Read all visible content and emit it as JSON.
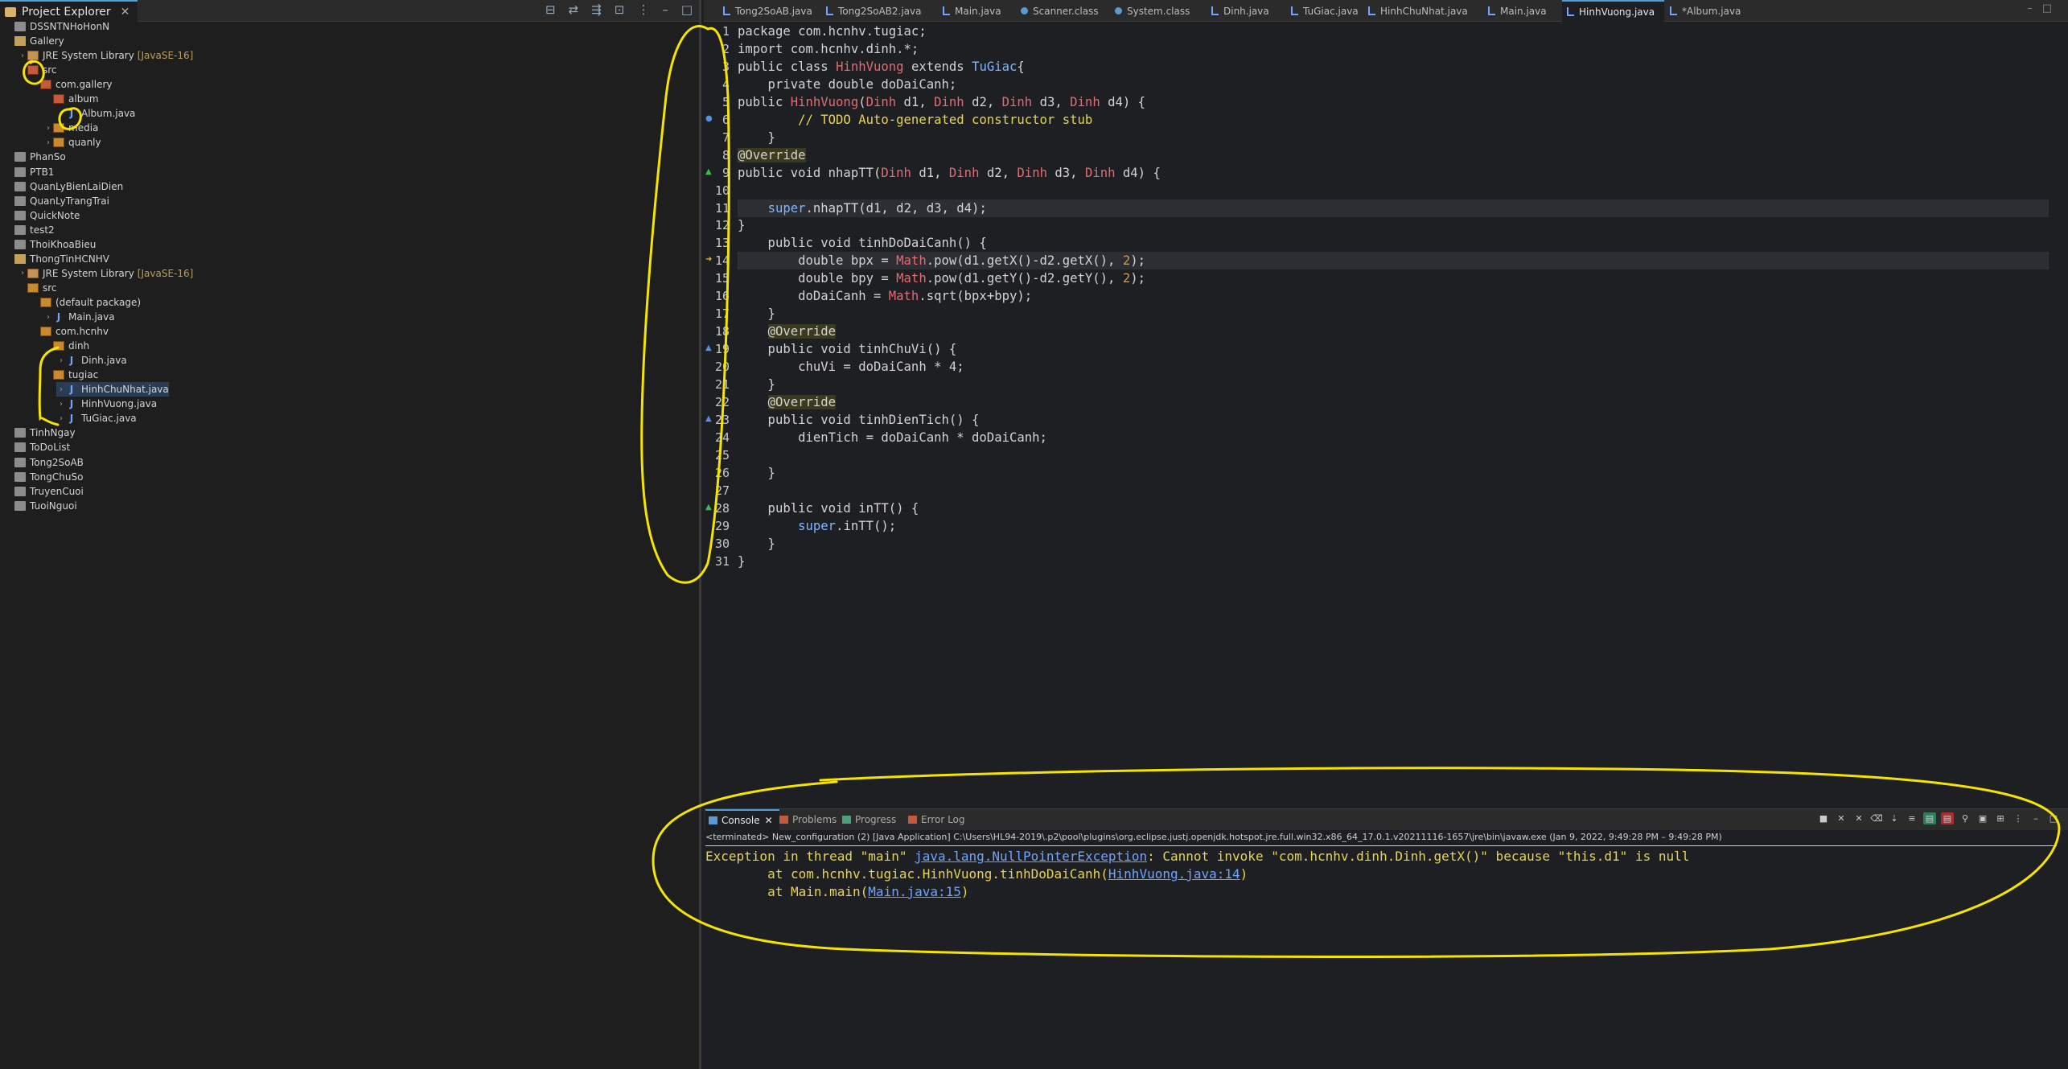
{
  "explorer": {
    "tab_label": "Project Explorer",
    "tree": [
      {
        "label": "DSSNTNHoHonN",
        "indent": 0,
        "kind": "folder"
      },
      {
        "label": "Gallery",
        "indent": 0,
        "kind": "folder-open"
      },
      {
        "label": "JRE System Library",
        "tag": "[JavaSE-16]",
        "indent": 1,
        "kind": "lib",
        "arrow": "›"
      },
      {
        "label": "src",
        "indent": 1,
        "kind": "pkg-err"
      },
      {
        "label": "com.gallery",
        "indent": 2,
        "kind": "pkg-err"
      },
      {
        "label": "album",
        "indent": 3,
        "kind": "pkg-err"
      },
      {
        "label": "Album.java",
        "indent": 4,
        "kind": "jfile"
      },
      {
        "label": "media",
        "indent": 3,
        "kind": "pkg",
        "arrow": "›"
      },
      {
        "label": "quanly",
        "indent": 3,
        "kind": "pkg",
        "arrow": "›"
      },
      {
        "label": "PhanSo",
        "indent": 0,
        "kind": "folder"
      },
      {
        "label": "PTB1",
        "indent": 0,
        "kind": "folder"
      },
      {
        "label": "QuanLyBienLaiDien",
        "indent": 0,
        "kind": "folder"
      },
      {
        "label": "QuanLyTrangTrai",
        "indent": 0,
        "kind": "folder"
      },
      {
        "label": "QuickNote",
        "indent": 0,
        "kind": "folder"
      },
      {
        "label": "test2",
        "indent": 0,
        "kind": "folder"
      },
      {
        "label": "ThoiKhoaBieu",
        "indent": 0,
        "kind": "folder"
      },
      {
        "label": "ThongTinHCNHV",
        "indent": 0,
        "kind": "folder-open"
      },
      {
        "label": "JRE System Library",
        "tag": "[JavaSE-16]",
        "indent": 1,
        "kind": "lib",
        "arrow": "›"
      },
      {
        "label": "src",
        "indent": 1,
        "kind": "pkg"
      },
      {
        "label": "(default package)",
        "indent": 2,
        "kind": "pkg"
      },
      {
        "label": "Main.java",
        "indent": 3,
        "kind": "jfile",
        "arrow": "›"
      },
      {
        "label": "com.hcnhv",
        "indent": 2,
        "kind": "pkg"
      },
      {
        "label": "dinh",
        "indent": 3,
        "kind": "pkg"
      },
      {
        "label": "Dinh.java",
        "indent": 4,
        "kind": "jfile",
        "arrow": "›"
      },
      {
        "label": "tugiac",
        "indent": 3,
        "kind": "pkg"
      },
      {
        "label": "HinhChuNhat.java",
        "indent": 4,
        "kind": "jfile",
        "arrow": "›",
        "selected": true
      },
      {
        "label": "HinhVuong.java",
        "indent": 4,
        "kind": "jfile",
        "arrow": "›"
      },
      {
        "label": "TuGiac.java",
        "indent": 4,
        "kind": "jfile",
        "arrow": "›"
      },
      {
        "label": "TinhNgay",
        "indent": 0,
        "kind": "folder"
      },
      {
        "label": "ToDoList",
        "indent": 0,
        "kind": "folder"
      },
      {
        "label": "Tong2SoAB",
        "indent": 0,
        "kind": "folder"
      },
      {
        "label": "TongChuSo",
        "indent": 0,
        "kind": "folder"
      },
      {
        "label": "TruyenCuoi",
        "indent": 0,
        "kind": "folder"
      },
      {
        "label": "TuoiNguoi",
        "indent": 0,
        "kind": "folder"
      }
    ]
  },
  "editor": {
    "tabs": [
      {
        "label": "Tong2SoAB.java",
        "kind": "java"
      },
      {
        "label": "Tong2SoAB2.java",
        "kind": "java"
      },
      {
        "label": "Main.java",
        "kind": "java"
      },
      {
        "label": "Scanner.class",
        "kind": "cls"
      },
      {
        "label": "System.class",
        "kind": "cls"
      },
      {
        "label": "Dinh.java",
        "kind": "java"
      },
      {
        "label": "TuGiac.java",
        "kind": "java"
      },
      {
        "label": "HinhChuNhat.java",
        "kind": "java"
      },
      {
        "label": "Main.java",
        "kind": "java"
      },
      {
        "label": "HinhVuong.java",
        "kind": "java",
        "active": true
      },
      {
        "label": "*Album.java",
        "kind": "java"
      }
    ],
    "lines": [
      "package com.hcnhv.tugiac;",
      "import com.hcnhv.dinh.*;",
      "public class HinhVuong extends TuGiac{",
      "    private double doDaiCanh;",
      "public HinhVuong(Dinh d1, Dinh d2, Dinh d3, Dinh d4) {",
      "        // TODO Auto-generated constructor stub",
      "    }",
      "@Override",
      "public void nhapTT(Dinh d1, Dinh d2, Dinh d3, Dinh d4) {",
      "",
      "    super.nhapTT(d1, d2, d3, d4);",
      "}",
      "    public void tinhDoDaiCanh() {",
      "        double bpx = Math.pow(d1.getX()-d2.getX(), 2);",
      "        double bpy = Math.pow(d1.getY()-d2.getY(), 2);",
      "        doDaiCanh = Math.sqrt(bpx+bpy);",
      "    }",
      "    @Override",
      "    public void tinhChuVi() {",
      "        chuVi = doDaiCanh * 4;",
      "    }",
      "    @Override",
      "    public void tinhDienTich() {",
      "        dienTich = doDaiCanh * doDaiCanh;",
      "",
      "    }",
      "",
      "    public void inTT() {",
      "        super.inTT();",
      "    }",
      "}"
    ],
    "line_numbers": [
      "1",
      "2",
      "3",
      "4",
      "5",
      "6",
      "7",
      "8",
      "9",
      "10",
      "11",
      "12",
      "13",
      "14",
      "15",
      "16",
      "17",
      "18",
      "19",
      "20",
      "21",
      "22",
      "23",
      "24",
      "25",
      "26",
      "27",
      "28",
      "29",
      "30",
      "31"
    ]
  },
  "console": {
    "tabs": [
      {
        "label": "Console",
        "active": true
      },
      {
        "label": "Problems"
      },
      {
        "label": "Progress"
      },
      {
        "label": "Error Log"
      }
    ],
    "status": "<terminated> New_configuration (2) [Java Application] C:\\Users\\HL94-2019\\.p2\\pool\\plugins\\org.eclipse.justj.openjdk.hotspot.jre.full.win32.x86_64_17.0.1.v20211116-1657\\jre\\bin\\javaw.exe  (Jan 9, 2022, 9:49:28 PM – 9:49:28 PM)",
    "output": {
      "line1_prefix": "Exception in thread \"main\" ",
      "line1_link": "java.lang.NullPointerException",
      "line1_suffix": ": Cannot invoke \"com.hcnhv.dinh.Dinh.getX()\" because \"this.d1\" is null",
      "line2_prefix": "\tat com.hcnhv.tugiac.HinhVuong.tinhDoDaiCanh(",
      "line2_link": "HinhVuong.java:14",
      "line2_suffix": ")",
      "line3_prefix": "\tat Main.main(",
      "line3_link": "Main.java:15",
      "line3_suffix": ")"
    }
  },
  "colors": {
    "annotation": "#f5e400",
    "accent": "#4f9ed8",
    "console_text": "#e8d44d",
    "link": "#6fa5ff"
  }
}
